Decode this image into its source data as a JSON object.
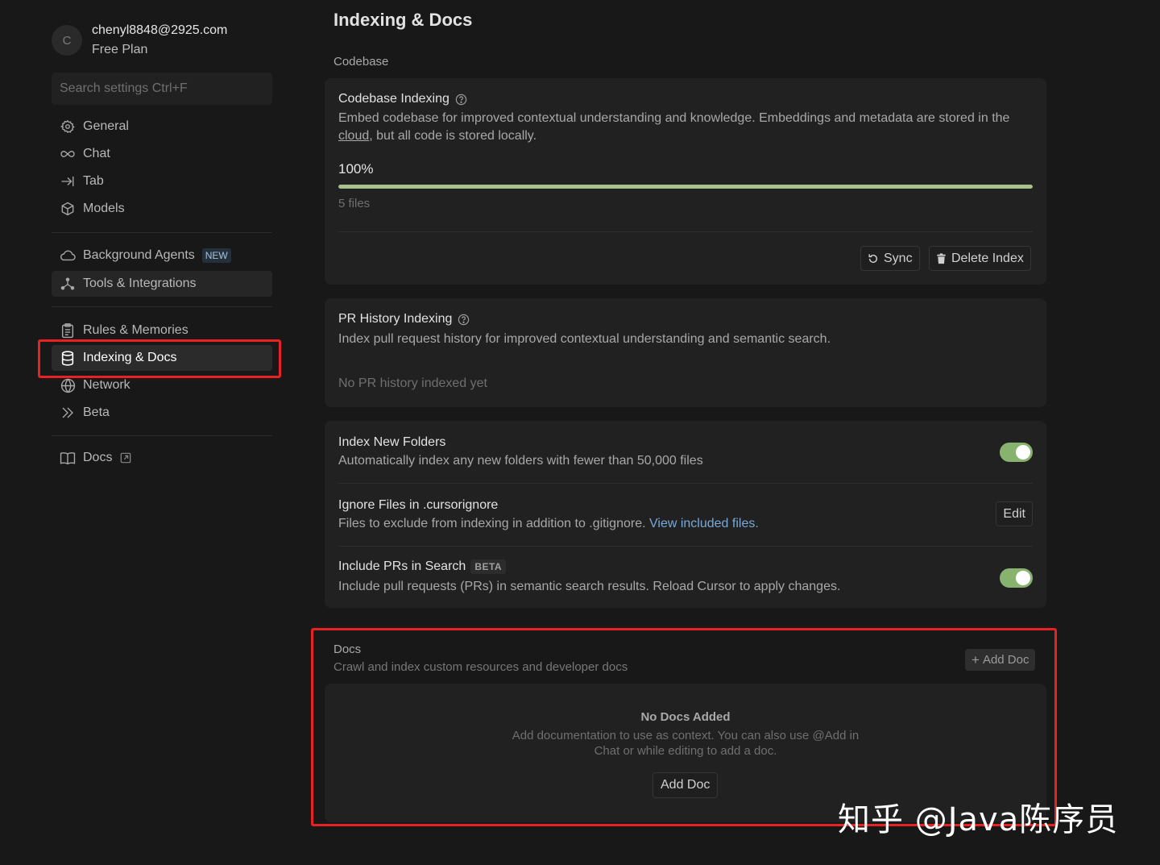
{
  "account": {
    "avatar_initial": "C",
    "email": "chenyl8848@2925.com",
    "plan": "Free Plan"
  },
  "sidebar": {
    "search_placeholder": "Search settings Ctrl+F",
    "items": [
      {
        "label": "General",
        "icon": "gear-icon"
      },
      {
        "label": "Chat",
        "icon": "infinity-icon"
      },
      {
        "label": "Tab",
        "icon": "tab-arrow-icon"
      },
      {
        "label": "Models",
        "icon": "cube-icon"
      },
      {
        "label": "Background Agents",
        "icon": "cloud-icon",
        "badge": "NEW"
      },
      {
        "label": "Tools & Integrations",
        "icon": "nodes-icon"
      },
      {
        "label": "Rules & Memories",
        "icon": "clipboard-icon"
      },
      {
        "label": "Indexing & Docs",
        "icon": "database-icon",
        "active": true
      },
      {
        "label": "Network",
        "icon": "globe-icon"
      },
      {
        "label": "Beta",
        "icon": "double-chevron-icon"
      },
      {
        "label": "Docs",
        "icon": "book-icon"
      }
    ]
  },
  "main": {
    "title": "Indexing & Docs",
    "codebase_label": "Codebase",
    "codebase_indexing": {
      "title": "Codebase Indexing",
      "desc_part1": "Embed codebase for improved contextual understanding and knowledge. Embeddings and metadata are stored in the ",
      "desc_link": "cloud",
      "desc_part2": ", but all code is stored locally.",
      "progress_label": "100%",
      "progress_fraction": 1.0,
      "files": "5 files",
      "sync_label": "Sync",
      "delete_label": "Delete Index"
    },
    "pr_history": {
      "title": "PR History Indexing",
      "desc": "Index pull request history for improved contextual understanding and semantic search.",
      "empty": "No PR history indexed yet"
    },
    "settings": {
      "new_folders_title": "Index New Folders",
      "new_folders_desc": "Automatically index any new folders with fewer than 50,000 files",
      "new_folders_on": true,
      "ignore_title": "Ignore Files in .cursorignore",
      "ignore_desc": "Files to exclude from indexing in addition to .gitignore. ",
      "ignore_link": "View included files.",
      "edit_label": "Edit",
      "prs_title": "Include PRs in Search",
      "prs_badge": "BETA",
      "prs_desc": "Include pull requests (PRs) in semantic search results. Reload Cursor to apply changes.",
      "prs_on": true
    },
    "docs": {
      "title": "Docs",
      "subtitle": "Crawl and index custom resources and developer docs",
      "add_label": "Add Doc",
      "empty_title": "No Docs Added",
      "empty_desc": "Add documentation to use as context. You can also use @Add in Chat or while editing to add a doc.",
      "empty_button": "Add Doc"
    }
  },
  "watermark": "知乎 @Java陈序员",
  "colors": {
    "background": "#181818",
    "card": "#212121",
    "progress": "#a7c18d",
    "toggle_on": "#88b36e",
    "highlight_box": "#e62222",
    "link": "#78a9d8"
  }
}
